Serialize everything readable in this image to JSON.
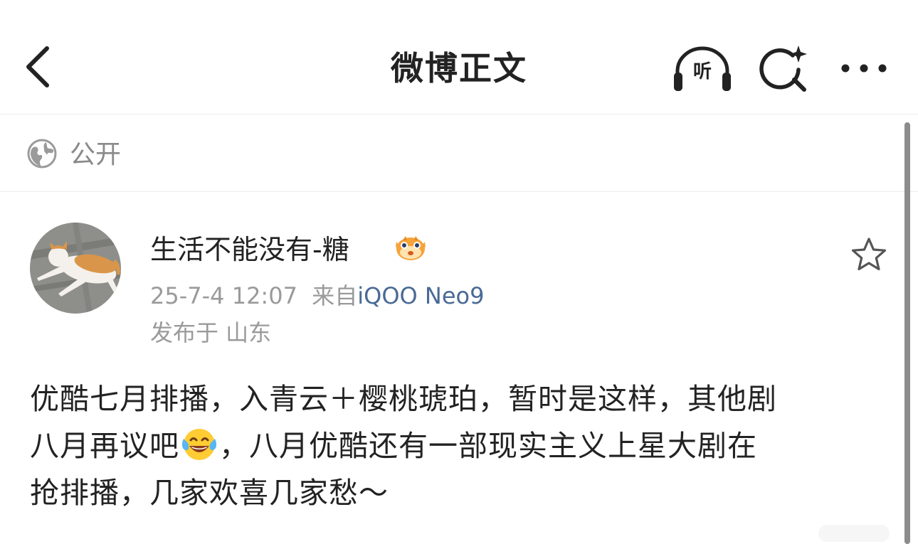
{
  "navbar": {
    "title": "微博正文",
    "listen_label": "听",
    "icons": {
      "back": "chevron-left-icon",
      "listen": "headphones-listen-icon",
      "search": "sparkle-search-icon",
      "more": "more-dots-icon"
    }
  },
  "visibility": {
    "label": "公开",
    "icon": "globe-icon"
  },
  "post": {
    "author": {
      "name": "生活不能没有-糖",
      "badge_icon": "pufferfish-badge-icon",
      "avatar": "orange-white-cat-avatar"
    },
    "meta": {
      "time": "25-7-4 12:07",
      "source_prefix": "来自",
      "device": "iQOO Neo9",
      "location": "发布于 山东"
    },
    "favorite_icon": "star-outline-icon",
    "body": {
      "line1": "优酷七月排播，入青云＋樱桃琥珀，暂时是这样，其他剧",
      "line2_before": "八月再议吧",
      "line2_emoji": "laughing-tears-emoji",
      "line2_after": "，八月优酷还有一部现实主义上星大剧在",
      "line3": "抢排播，几家欢喜几家愁～"
    }
  },
  "colors": {
    "text_primary": "#222222",
    "text_secondary": "#9a9a9a",
    "device_link": "#4a6a95",
    "divider": "#ececec"
  }
}
